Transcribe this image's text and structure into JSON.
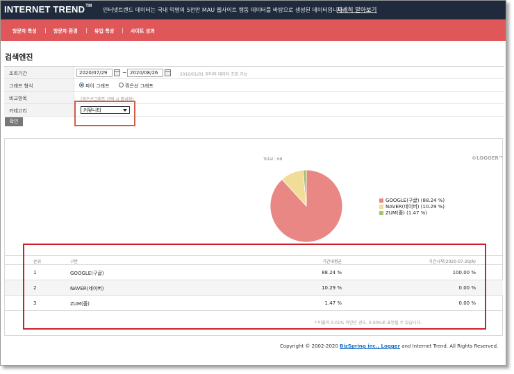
{
  "header": {
    "brand": "INTERNET TREND",
    "brand_tm": "TM",
    "tagline": "인터넷트렌드 데이터는 국내 익명의 5천만 MAU 웹사이트 행동 데이터를 바탕으로 생성된 데이터입니다.",
    "learn_more": "자세히 알아보기"
  },
  "nav": {
    "items": [
      "방문자 특성",
      "방문자 환경",
      "유입 특성",
      "사이트 성과"
    ]
  },
  "page": {
    "title": "검색엔진"
  },
  "form": {
    "period_label": "조회기간",
    "start_date": "2020/07/29",
    "tilde": "~",
    "end_date": "2020/08/26",
    "period_hint": "· 2010/01/01 부터의 데이터 조회 가능",
    "graph_type_label": "그래프 형식",
    "graph_options": [
      "파이 그래프",
      "꺾은선 그래프"
    ],
    "selected_graph": "파이 그래프",
    "compare_label": "비교항목",
    "compare_note": "(꺾은선그래프 선택 시 활성됨)",
    "category_label": "카테고리",
    "category_value": "커뮤니티",
    "confirm_label": "확인"
  },
  "chart": {
    "total_label": "Total : 68",
    "logger_mark": "©LOGGER™"
  },
  "chart_data": {
    "type": "pie",
    "categories": [
      "GOOGLE(구글)",
      "NAVER(네이버)",
      "ZUM(줌)"
    ],
    "values": [
      88.24,
      10.29,
      1.47
    ],
    "legend_labels": [
      "GOOGLE(구글)  (88.24 %)",
      "NAVER(네이버)  (10.29 %)",
      "ZUM(줌)  (1.47 %)"
    ],
    "colors": [
      "#e88784",
      "#f2dd98",
      "#a3c46a"
    ],
    "legend_position": "right"
  },
  "table": {
    "headers": {
      "rank": "순위",
      "name": "구분",
      "avg": "기간내평균",
      "start": "기간시작(2020-07-29/A)"
    },
    "rows": [
      {
        "rank": "1",
        "name": "GOOGLE(구글)",
        "avg": "88.24 %",
        "start": "100.00 %"
      },
      {
        "rank": "2",
        "name": "NAVER(네이버)",
        "avg": "10.29 %",
        "start": "0.00 %"
      },
      {
        "rank": "3",
        "name": "ZUM(줌)",
        "avg": "1.47 %",
        "start": "0.00 %"
      }
    ],
    "footnote": "* 비율이 0.01% 미만인 경우, 0.00%로 표현될 수 있습니다."
  },
  "footer": {
    "prefix": "Copyright © 2002-2020 ",
    "link": "BizSpring inc., Logger",
    "suffix": " and Internet Trend. All Rights Reserved."
  },
  "annotations": {
    "box_color": "#cc1f2a",
    "category_box_color": "#cf5f4a"
  }
}
